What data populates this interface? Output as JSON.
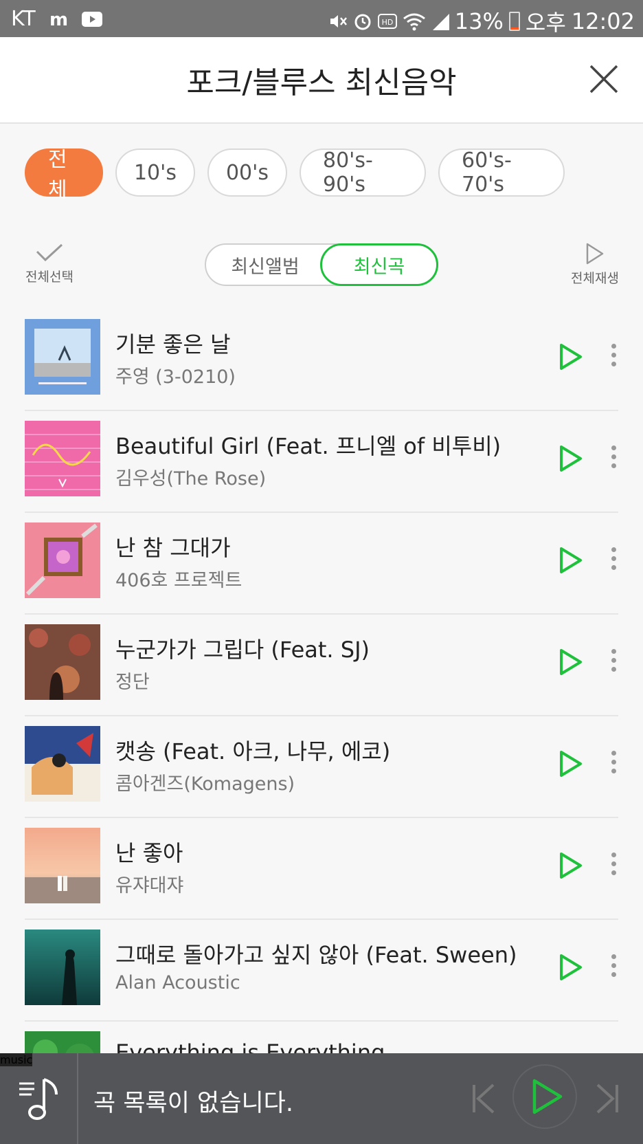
{
  "status_bar": {
    "carrier": "KT",
    "battery": "13%",
    "battery_level": 0.13,
    "ampm": "오후",
    "time": "12:02",
    "icons": [
      "m-icon",
      "youtube-icon",
      "mute-icon",
      "alarm-icon",
      "hd-icon",
      "wifi-icon",
      "signal-icon",
      "battery-icon"
    ]
  },
  "header": {
    "title": "포크/블루스 최신음악",
    "close_icon": "close-icon"
  },
  "filters": [
    {
      "label": "전체",
      "active": true
    },
    {
      "label": "10's",
      "active": false
    },
    {
      "label": "00's",
      "active": false
    },
    {
      "label": "80's-90's",
      "active": false
    },
    {
      "label": "60's-70's",
      "active": false
    }
  ],
  "toolbar": {
    "select_all": "전체선택",
    "tab_album": "최신앨범",
    "tab_song": "최신곡",
    "play_all": "전체재생"
  },
  "songs": [
    {
      "title": "기분 좋은 날",
      "artist": "주영 (3-0210)"
    },
    {
      "title": "Beautiful Girl (Feat. 프니엘 of 비투비)",
      "artist": "김우성(The Rose)"
    },
    {
      "title": "난 참 그대가",
      "artist": "406호 프로젝트"
    },
    {
      "title": "누군가가 그립다 (Feat. SJ)",
      "artist": "정단"
    },
    {
      "title": "캣송 (Feat. 아크, 나무, 에코)",
      "artist": "콤아겐즈(Komagens)"
    },
    {
      "title": "난 좋아",
      "artist": "유쟈대쟈"
    },
    {
      "title": "그때로 돌아가고 싶지 않아 (Feat. Sween)",
      "artist": "Alan Acoustic"
    },
    {
      "title": "Everything is Everything",
      "artist": ""
    }
  ],
  "player": {
    "badge": "music",
    "message": "곡 목록이 없습니다."
  },
  "colors": {
    "accent_orange": "#f47b40",
    "accent_green": "#1fc13c",
    "player_bg": "#535559"
  }
}
